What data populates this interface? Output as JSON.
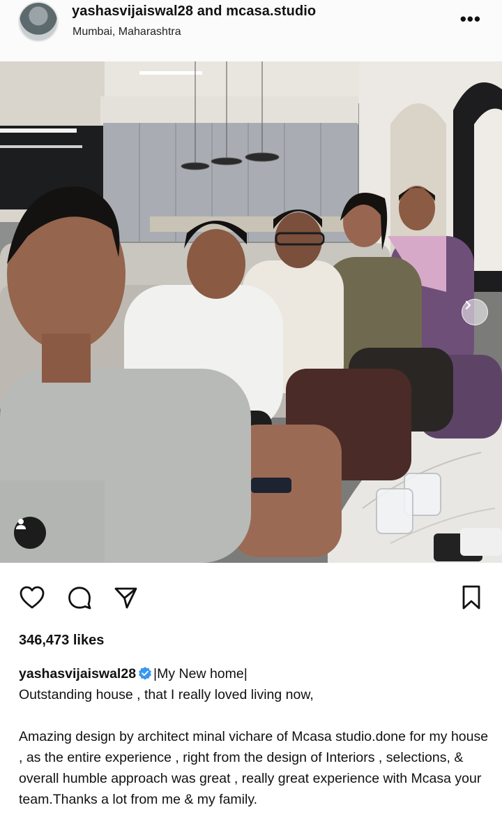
{
  "post": {
    "authors": "yashasvijaiswal28 and mcasa.studio",
    "location": "Mumbai, Maharashtra",
    "more_icon": "more-horizontal-icon"
  },
  "actions": {
    "like_icon": "heart-icon",
    "comment_icon": "comment-icon",
    "share_icon": "send-icon",
    "save_icon": "bookmark-icon"
  },
  "likes": "346,473 likes",
  "caption": {
    "username": "yashasvijaiswal28",
    "title": "|My New home|",
    "line1": "Outstanding house , that I really loved living now,",
    "body": "Amazing design by architect minal vichare of Mcasa studio.done for my house , as the entire experience , right from the design of Interiors , selections, & overall humble approach was great , really great experience with Mcasa your team.Thanks a lot from me & my family."
  },
  "colors": {
    "verified_blue": "#3897f0",
    "text": "#111111"
  }
}
